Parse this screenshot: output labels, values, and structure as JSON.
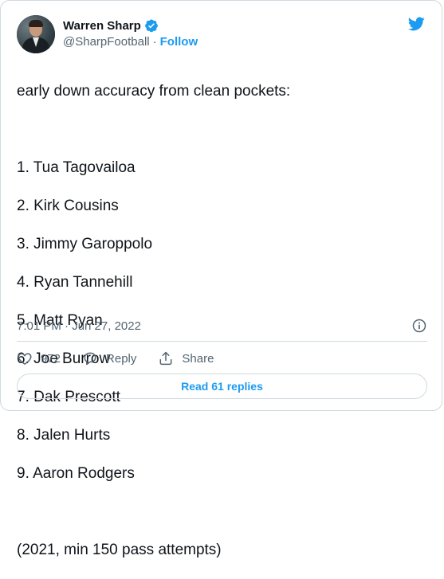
{
  "author": {
    "name": "Warren Sharp",
    "handle": "@SharpFootball",
    "separator": "·",
    "follow_label": "Follow",
    "verified": true
  },
  "tweet": {
    "lines": [
      "early down accuracy from clean pockets:",
      "",
      "1. Tua Tagovailoa",
      "2. Kirk Cousins",
      "3. Jimmy Garoppolo",
      "4. Ryan Tannehill",
      "5. Matt Ryan",
      "6. Joe Burrow",
      "7. Dak Prescott",
      "8. Jalen Hurts",
      "9. Aaron Rodgers",
      "",
      "(2021, min 150 pass attempts)"
    ]
  },
  "timestamp": "7:01 PM · Jun 27, 2022",
  "actions": {
    "like_count": "972",
    "reply_label": "Reply",
    "share_label": "Share"
  },
  "replies_button": "Read 61 replies",
  "colors": {
    "accent": "#1d9bf0",
    "text": "#0f1419",
    "muted": "#536471",
    "border": "#cfd9de"
  },
  "icons": [
    "verified-badge-icon",
    "twitter-bird-icon",
    "info-icon",
    "heart-icon",
    "reply-icon",
    "share-icon"
  ]
}
